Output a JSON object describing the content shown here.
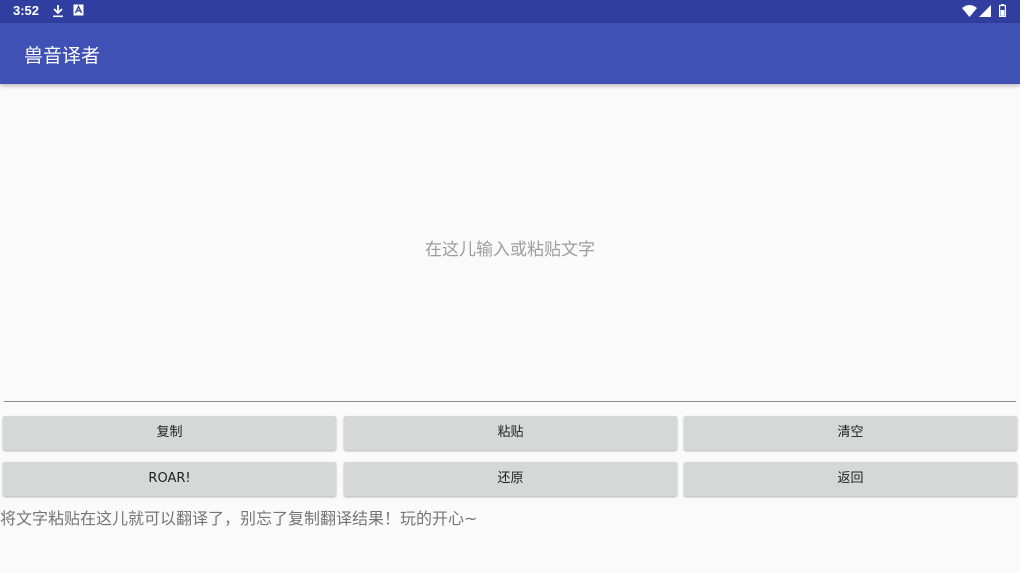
{
  "status_bar": {
    "time": "3:52",
    "icons": [
      "download-icon",
      "app-notification-icon",
      "wifi-icon",
      "signal-icon",
      "battery-icon"
    ]
  },
  "app_bar": {
    "title": "兽音译者"
  },
  "input": {
    "placeholder": "在这儿输入或粘贴文字",
    "value": ""
  },
  "buttons": {
    "copy": "复制",
    "paste": "粘贴",
    "clear": "清空",
    "roar": "ROAR!",
    "restore": "还原",
    "back": "返回"
  },
  "hint": "将文字粘贴在这儿就可以翻译了，别忘了复制翻译结果！玩的开心~",
  "colors": {
    "status_bar": "#303f9f",
    "app_bar": "#3f51b5",
    "background": "#fafafa",
    "button": "#d6d7d7",
    "placeholder": "#9e9e9e"
  }
}
